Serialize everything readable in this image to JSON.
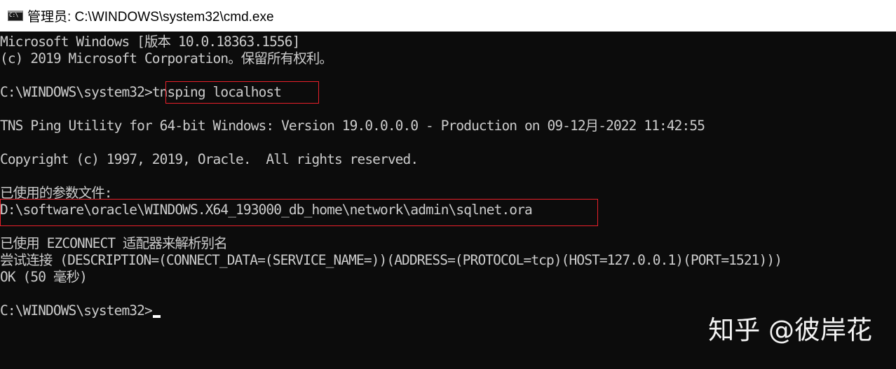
{
  "window": {
    "icon": "cmd-icon",
    "icon_glyph": "C:\\",
    "title": "管理员: C:\\WINDOWS\\system32\\cmd.exe"
  },
  "console": {
    "lines": [
      "Microsoft Windows [版本 10.0.18363.1556]",
      "(c) 2019 Microsoft Corporation。保留所有权利。",
      "",
      "C:\\WINDOWS\\system32>",
      "",
      "TNS Ping Utility for 64-bit Windows: Version 19.0.0.0.0 - Production on 09-12月-2022 11:42:55",
      "",
      "Copyright (c) 1997, 2019, Oracle.  All rights reserved.",
      "",
      "已使用的参数文件:",
      "D:\\software\\oracle\\WINDOWS.X64_193000_db_home\\network\\admin\\sqlnet.ora",
      "",
      "已使用 EZCONNECT 适配器来解析别名",
      "尝试连接 (DESCRIPTION=(CONNECT_DATA=(SERVICE_NAME=))(ADDRESS=(PROTOCOL=tcp)(HOST=127.0.0.1)(PORT=1521)))",
      "OK (50 毫秒)",
      "",
      "C:\\WINDOWS\\system32>"
    ],
    "command": "tnsping localhost",
    "highlight_color": "#e8202a",
    "text_color": "#cccccc",
    "background_color": "#0c0c0c"
  },
  "watermark": {
    "text": "知乎 @彼岸花"
  }
}
